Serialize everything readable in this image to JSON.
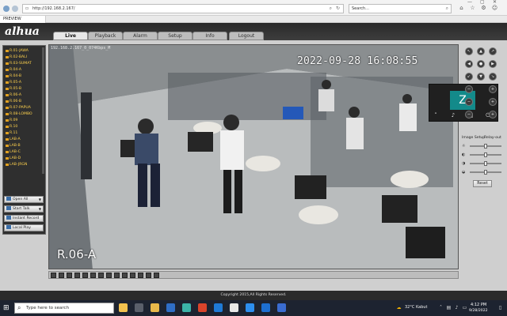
{
  "browser": {
    "url": "http://192.168.2.167/",
    "search_placeholder": "Search...",
    "tab_label": "PREVIEW",
    "colors": {
      "chrome": "#f3f3f3"
    }
  },
  "app": {
    "logo": "alhua",
    "tabs": [
      {
        "label": "Live",
        "active": true
      },
      {
        "label": "Playback",
        "active": false
      },
      {
        "label": "Alarm",
        "active": false
      },
      {
        "label": "Setup",
        "active": false
      },
      {
        "label": "Info",
        "active": false
      },
      {
        "label": "Logout",
        "active": false
      }
    ]
  },
  "camera_list": [
    "R.01-JAWA",
    "R.02-BALI",
    "R.03-SUMAT",
    "R.04-A",
    "R.04-B",
    "R.05-A",
    "R.05-B",
    "R.06-A",
    "R.06-B",
    "R.07-PAPUA",
    "R.08-LOMBO",
    "R.09",
    "R.10",
    "R.11",
    "LAB-A",
    "LAB-B",
    "LAB-C",
    "LAB-D",
    "LAB-JRGN"
  ],
  "left_buttons": {
    "open_all": "Open All",
    "start_talk": "Start Talk",
    "instant_record": "Instant Record",
    "local_play": "Local Play"
  },
  "video": {
    "stream_info": "192.168.2.167_0_074Kbps_M",
    "timestamp": "2022-09-28 16:08:55",
    "channel": "R.06-A"
  },
  "meeting": {
    "avatar_initial": "Z",
    "avatar_color": "#138a8a"
  },
  "ptz": {
    "image_setup_label": "Image Setup",
    "relay_out_label": "Relay-out",
    "sliders": [
      0.5,
      0.5,
      0.5,
      0.5
    ],
    "reset_label": "Reset"
  },
  "footer": {
    "copyright": "Copyright 2015,All Rights Reserved."
  },
  "taskbar": {
    "search_placeholder": "Type here to search",
    "weather": "32°C  Kabut",
    "time": "4:12 PM",
    "date": "9/28/2022"
  }
}
